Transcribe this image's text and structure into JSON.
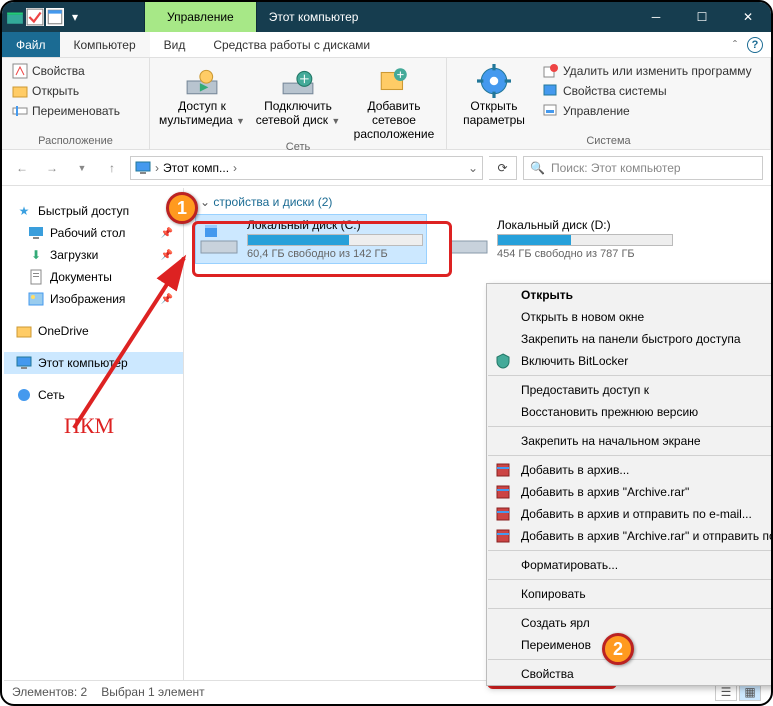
{
  "titlebar": {
    "manage_tab": "Управление",
    "title": "Этот компьютер"
  },
  "menubar": {
    "file": "Файл",
    "computer": "Компьютер",
    "view": "Вид",
    "disk_tools": "Средства работы с дисками"
  },
  "ribbon": {
    "location": {
      "properties": "Свойства",
      "open": "Открыть",
      "rename": "Переименовать",
      "group": "Расположение"
    },
    "network": {
      "media": "Доступ к мультимедиа",
      "map_drive": "Подключить сетевой диск",
      "add_location": "Добавить сетевое расположение",
      "group": "Сеть"
    },
    "system": {
      "open_settings": "Открыть параметры",
      "uninstall": "Удалить или изменить программу",
      "sys_props": "Свойства системы",
      "manage": "Управление",
      "group": "Система"
    }
  },
  "address": {
    "crumb": "Этот комп...",
    "search_placeholder": "Поиск: Этот компьютер"
  },
  "sidebar": {
    "quick": "Быстрый доступ",
    "desktop": "Рабочий стол",
    "downloads": "Загрузки",
    "documents": "Документы",
    "pictures": "Изображения",
    "onedrive": "OneDrive",
    "thispc": "Этот компьютер",
    "network": "Сеть"
  },
  "content": {
    "section": "стройства и диски (2)",
    "drives": [
      {
        "name": "Локальный диск (C:)",
        "free": "60,4 ГБ свободно из 142 ГБ",
        "fill_pct": 58
      },
      {
        "name": "Локальный диск (D:)",
        "free": "454 ГБ свободно из 787 ГБ",
        "fill_pct": 42
      }
    ]
  },
  "context_menu": {
    "open": "Открыть",
    "open_new": "Открыть в новом окне",
    "pin_quick": "Закрепить на панели быстрого доступа",
    "bitlocker": "Включить BitLocker",
    "grant_access": "Предоставить доступ к",
    "restore_prev": "Восстановить прежнюю версию",
    "pin_start": "Закрепить на начальном экране",
    "add_archive": "Добавить в архив...",
    "add_archive_rar": "Добавить в архив \"Archive.rar\"",
    "archive_email": "Добавить в архив и отправить по e-mail...",
    "archive_rar_email": "Добавить в архив \"Archive.rar\" и отправить по e-mail",
    "format": "Форматировать...",
    "copy": "Копировать",
    "create_shortcut": "Создать ярл",
    "rename": "Переименов",
    "properties": "Свойства"
  },
  "statusbar": {
    "count": "Элементов: 2",
    "selected": "Выбран 1 элемент"
  },
  "annotations": {
    "pkm": "ПКМ"
  }
}
